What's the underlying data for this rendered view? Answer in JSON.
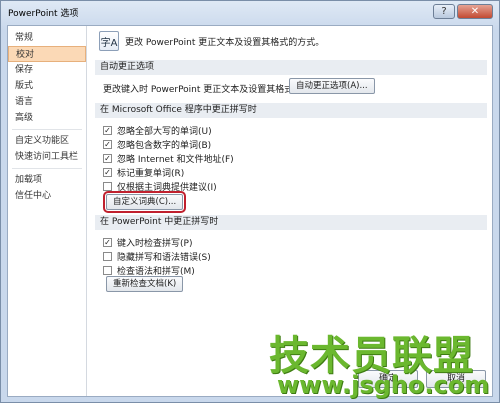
{
  "window": {
    "title": "PowerPoint 选项",
    "help_glyph": "?",
    "close_glyph": "✕"
  },
  "sidebar": {
    "items": [
      {
        "label": "常规",
        "selected": false
      },
      {
        "label": "校对",
        "selected": true
      },
      {
        "label": "保存",
        "selected": false
      },
      {
        "label": "版式",
        "selected": false
      },
      {
        "label": "语言",
        "selected": false
      },
      {
        "label": "高级",
        "selected": false
      },
      {
        "label": "自定义功能区",
        "selected": false
      },
      {
        "label": "快速访问工具栏",
        "selected": false
      },
      {
        "label": "加载项",
        "selected": false
      },
      {
        "label": "信任中心",
        "selected": false
      }
    ]
  },
  "header": {
    "icon_glyph": "字A",
    "text": "更改 PowerPoint 更正文本及设置其格式的方式。"
  },
  "autocorrect": {
    "section_title": "自动更正选项",
    "description": "更改键入时 PowerPoint 更正文本及设置其格式的方式:",
    "button_label": "自动更正选项(A)..."
  },
  "office_spelling": {
    "section_title": "在 Microsoft Office 程序中更正拼写时",
    "options": [
      {
        "label": "忽略全部大写的单词(U)",
        "checked": true
      },
      {
        "label": "忽略包含数字的单词(B)",
        "checked": true
      },
      {
        "label": "忽略 Internet 和文件地址(F)",
        "checked": true
      },
      {
        "label": "标记重复单词(R)",
        "checked": true
      },
      {
        "label": "仅根据主词典提供建议(I)",
        "checked": false
      }
    ],
    "custom_dict_label": "自定义词典(C)..."
  },
  "ppt_spelling": {
    "section_title": "在 PowerPoint 中更正拼写时",
    "options": [
      {
        "label": "键入时检查拼写(P)",
        "checked": true
      },
      {
        "label": "隐藏拼写和语法错误(S)",
        "checked": false
      },
      {
        "label": "检查语法和拼写(M)",
        "checked": false
      }
    ],
    "recheck_label": "重新检查文档(K)"
  },
  "footer": {
    "ok_label": "确定",
    "cancel_label": "取消"
  },
  "watermark": {
    "main": "技术员联盟",
    "url": "www.jsgho.com"
  },
  "colors": {
    "accent_highlight": "#c0202e",
    "selected_nav": "#fbd9b6",
    "watermark": "#6bb82f"
  }
}
